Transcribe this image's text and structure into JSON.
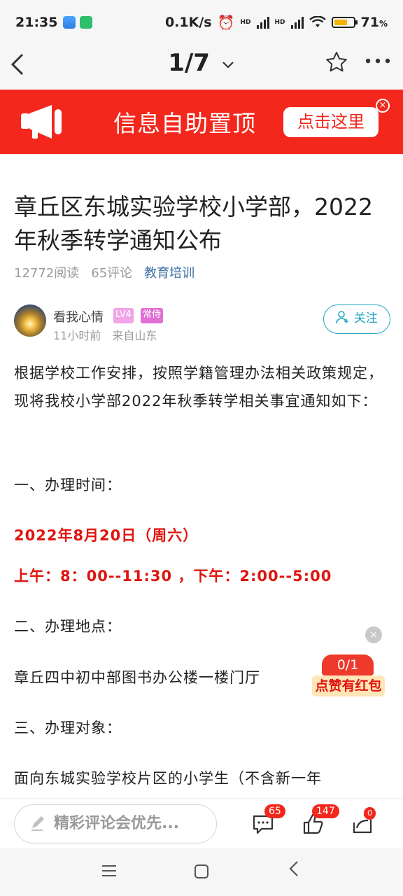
{
  "status": {
    "time": "21:35",
    "speed": "0.1K/s",
    "battery": "71",
    "battery_unit": "%",
    "battery_level": 0.71,
    "hd1": "HD",
    "hd2": "HD"
  },
  "nav": {
    "page": "1/7",
    "back_icon": "chevron-left-icon",
    "chevron": "⌄",
    "star_icon": "star-icon",
    "more_icon": "more-icon"
  },
  "banner": {
    "text": "信息自助置顶",
    "button": "点击这里",
    "close": "×",
    "bg": "#f3271c"
  },
  "article": {
    "title": "章丘区东城实验学校小学部，2022年秋季转学通知公布",
    "reads": "12772阅读",
    "comments": "65评论",
    "category": "教育培训",
    "author": {
      "name": "看我心情",
      "level": "LV4",
      "tag": "常侍",
      "time": "11小时前",
      "location": "来自山东",
      "follow": "关注"
    },
    "p1": "根据学校工作安排，按照学籍管理办法相关政策规定，现将我校小学部2022年秋季转学相关事宜通知如下：",
    "h1": "一、办理时间：",
    "date": "2022年8月20日（周六）",
    "hours": "上午：8：00--11:30 ，下午：2:00--5:00",
    "h2": "二、办理地点：",
    "place": "章丘四中初中部图书办公楼一楼门厅",
    "h3": "三、办理对象：",
    "p_last": "面向东城实验学校片区的小学生（不含新一年"
  },
  "floating": {
    "count": "0/1",
    "label": "点赞有红包",
    "close": "×"
  },
  "bottom": {
    "placeholder": "精彩评论会优先...",
    "comments_count": "65",
    "likes_count": "147",
    "share_badge": "0",
    "accent": "#f3271c"
  }
}
